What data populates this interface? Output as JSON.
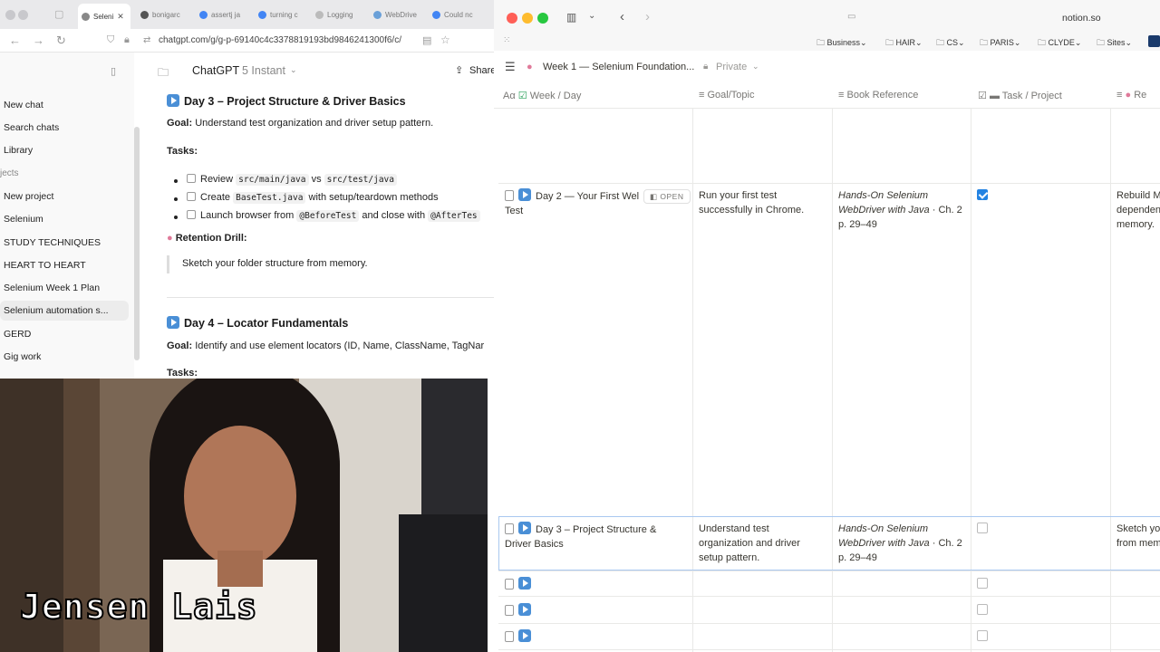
{
  "left_browser": {
    "tabs": [
      {
        "label": "Seleni",
        "active": true
      },
      {
        "label": "bonigarc"
      },
      {
        "label": "assertj ja"
      },
      {
        "label": "turning c"
      },
      {
        "label": "Logging"
      },
      {
        "label": "WebDrive"
      },
      {
        "label": "Could nc"
      }
    ],
    "url": "chatgpt.com/g/g-p-69140c4c3378819193bd9846241300f6/c/",
    "sidebar": {
      "items": [
        {
          "label": "New chat"
        },
        {
          "label": "Search chats"
        },
        {
          "label": "Library"
        },
        {
          "label": "jects"
        },
        {
          "label": "New project"
        },
        {
          "label": "Selenium"
        },
        {
          "label": "STUDY TECHNIQUES"
        },
        {
          "label": "HEART TO HEART"
        },
        {
          "label": "Selenium Week 1 Plan"
        },
        {
          "label": "Selenium automation s...",
          "selected": true
        },
        {
          "label": "GERD"
        },
        {
          "label": "Gig work"
        }
      ]
    },
    "chat": {
      "model_name": "ChatGPT",
      "model_variant": "5 Instant",
      "share_label": "Share",
      "day3": {
        "title": "Day 3 – Project Structure & Driver Basics",
        "goal_label": "Goal:",
        "goal_text": "Understand test organization and driver setup pattern.",
        "tasks_label": "Tasks:",
        "task1_pre": "Review",
        "task1_code1": "src/main/java",
        "task1_mid": "vs",
        "task1_code2": "src/test/java",
        "task2_pre": "Create",
        "task2_code": "BaseTest.java",
        "task2_post": "with setup/teardown methods",
        "task3_pre": "Launch browser from",
        "task3_code1": "@BeforeTest",
        "task3_mid": "and close with",
        "task3_code2": "@AfterTes",
        "retention_label": "Retention Drill:",
        "retention_text": "Sketch your folder structure from memory."
      },
      "day4": {
        "title": "Day 4 – Locator Fundamentals",
        "goal_label": "Goal:",
        "goal_text": "Identify and use element locators (ID, Name, ClassName, TagNar",
        "tasks_label": "Tasks:"
      }
    }
  },
  "webcam": {
    "caption": "Jensen Lais"
  },
  "notion": {
    "domain": "notion.so",
    "bookmarks": [
      "Business",
      "HAIR",
      "CS",
      "PARIS",
      "CLYDE",
      "Sites"
    ],
    "page_title": "Week 1 — Selenium Foundation...",
    "privacy": "Private",
    "columns": {
      "week_day": "Week / Day",
      "goal": "Goal/Topic",
      "book": "Book Reference",
      "task": "Task / Project",
      "re": "Re"
    },
    "open_label": "OPEN",
    "rows": [
      {
        "title": "Day 2 — Your First Web Test",
        "title_line1": "Day 2 — Your First Wel",
        "title_line2": "Test",
        "goal_l1": "Run your first test",
        "goal_l2": "successfully in Chrome.",
        "book_l1": "Hands-On Selenium",
        "book_l2a": "WebDriver with Java",
        "book_l2b": " · Ch. 2",
        "book_l3": "p. 29–49",
        "checked": true,
        "extra_l1": "Rebuild M",
        "extra_l2": "dependen",
        "extra_l3": "memory."
      },
      {
        "title_line1": "Day 3 – Project Structure &",
        "title_line2": "Driver Basics",
        "goal_l1": "Understand test",
        "goal_l2": "organization and driver",
        "goal_l3": "setup pattern.",
        "book_l1": "Hands-On Selenium",
        "book_l2a": "WebDriver with Java",
        "book_l2b": " · Ch. 2",
        "book_l3": "p. 29–49",
        "checked": false,
        "extra_l1": "Sketch yo",
        "extra_l2": "from mem"
      }
    ]
  }
}
